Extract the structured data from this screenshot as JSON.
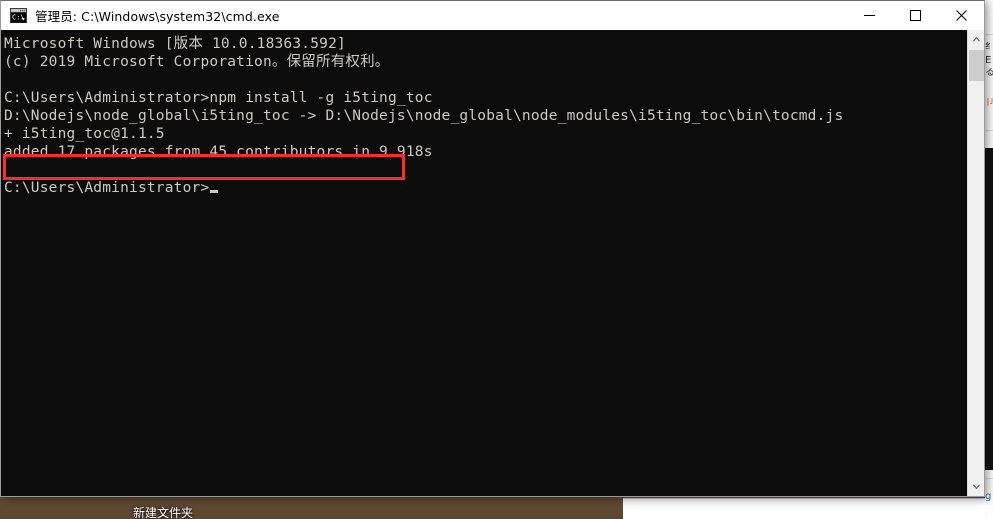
{
  "window": {
    "title": "管理员: C:\\Windows\\system32\\cmd.exe",
    "icon": "cmd-console-icon",
    "controls": {
      "minimize": "—",
      "maximize": "□",
      "close": "✕"
    }
  },
  "console": {
    "background_color": "#0c0c0c",
    "text_color": "#ccc9c2",
    "lines": [
      "Microsoft Windows [版本 10.0.18363.592]",
      "(c) 2019 Microsoft Corporation。保留所有权利。",
      "",
      "C:\\Users\\Administrator>npm install -g i5ting_toc",
      "D:\\Nodejs\\node_global\\i5ting_toc -> D:\\Nodejs\\node_global\\node_modules\\i5ting_toc\\bin\\tocmd.js",
      "+ i5ting_toc@1.1.5",
      "added 17 packages from 45 contributors in 9.918s",
      "",
      "C:\\Users\\Administrator>"
    ],
    "prompt_line": "C:\\Users\\Administrator>",
    "cursor_visible": true
  },
  "annotation": {
    "type": "rectangle-highlight",
    "color": "#ff2a2a",
    "target_text": "added 17 packages from 45 contributors in 9.918s"
  },
  "scrollbar": {
    "up_arrow": "▲",
    "down_arrow": "▼",
    "thumb_color": "#cdcdcd",
    "track_color": "#f0f0f0"
  },
  "desktop": {
    "folder_label": "新建文件夹"
  }
}
